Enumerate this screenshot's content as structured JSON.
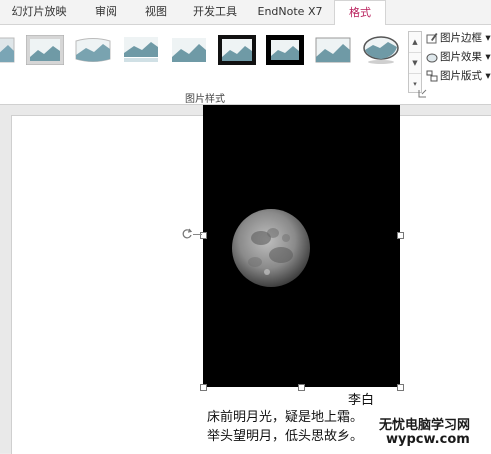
{
  "tabs": [
    {
      "label": "幻灯片放映",
      "active": false
    },
    {
      "label": "审阅",
      "active": false
    },
    {
      "label": "视图",
      "active": false
    },
    {
      "label": "开发工具",
      "active": false
    },
    {
      "label": "EndNote X7",
      "active": false
    },
    {
      "label": "格式",
      "active": true
    }
  ],
  "ribbon": {
    "group_label": "图片样式",
    "options": [
      {
        "label": "图片边框",
        "icon": "pen-border-icon"
      },
      {
        "label": "图片效果",
        "icon": "picture-effects-icon"
      },
      {
        "label": "图片版式",
        "icon": "picture-layout-icon"
      }
    ],
    "picture_styles_count": 8
  },
  "slide": {
    "image": "moon-photo",
    "poem": {
      "author": "李白",
      "lines": [
        "床前明月光，疑是地上霜。",
        "举头望明月，低头思故乡。"
      ]
    }
  },
  "watermark": {
    "title": "无忧电脑学习网",
    "url": "wypcw.com"
  },
  "colors": {
    "active_tab": "#b81d5a",
    "photo_bg": "#000000"
  }
}
